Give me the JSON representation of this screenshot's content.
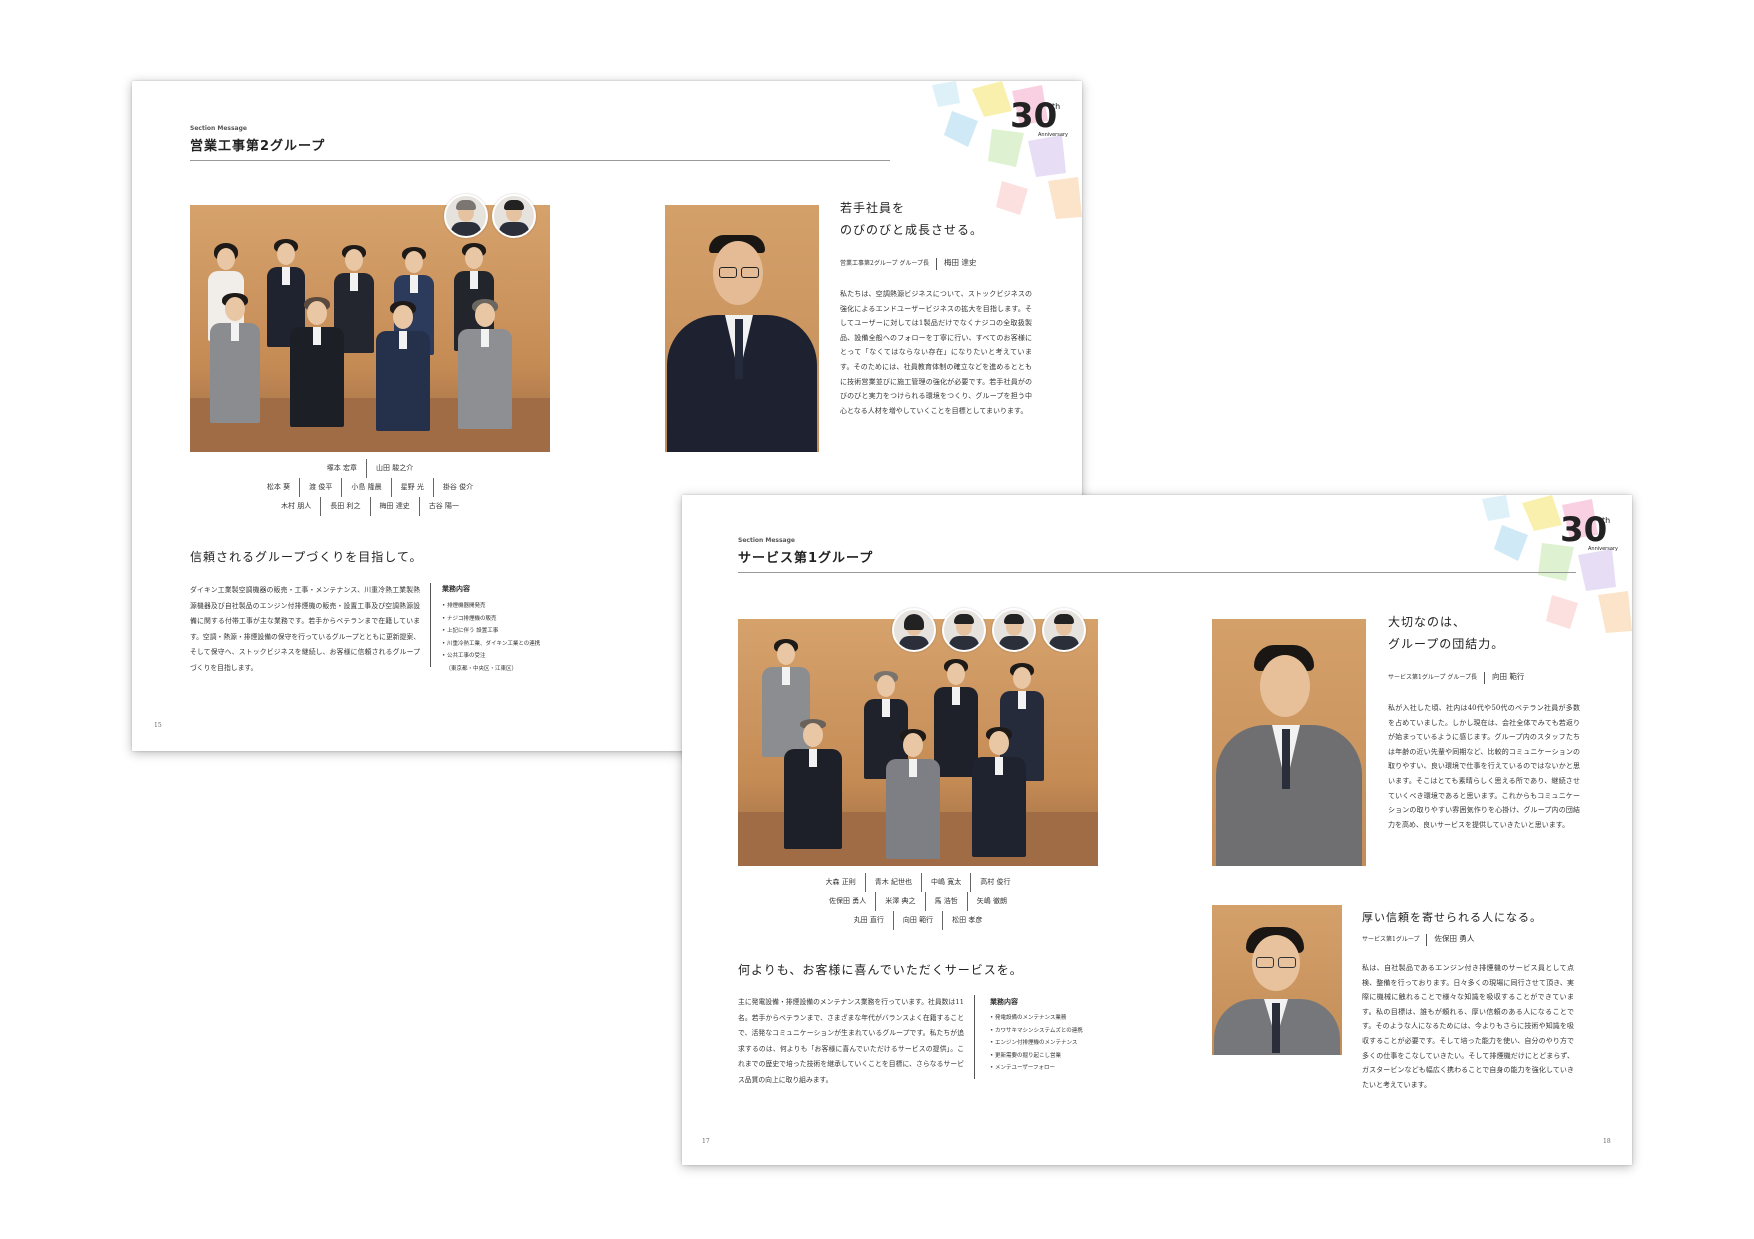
{
  "back_page": {
    "section_label": "Section Message",
    "section_title": "営業工事第2グループ",
    "headline": "若手社員を\nのびのびと成長させる。",
    "leader_role": "営業工事第2グループ グループ長",
    "leader_name": "梅田 達史",
    "leader_message": "私たちは、空調熱源ビジネスについて、ストックビジネスの強化によるエンドユーザービジネスの拡大を目指します。そしてユーザーに対しては1製品だけでなくナジコの全取扱製品、設備全般へのフォローを丁寧に行い、すべてのお客様にとって「なくてはならない存在」になりたいと考えています。そのためには、社員教育体制の確立などを進めるとともに技術営業並びに施工管理の強化が必要です。若手社員がのびのびと実力をつけられる環境をつくり、グループを担う中心となる人材を増やしていくことを目標としてまいります。",
    "name_rows": [
      [
        "塚本 宏章",
        "山田 駿之介"
      ],
      [
        "松本 葵",
        "渡 俊平",
        "小島 隆晨",
        "星野 光",
        "掛谷 俊介"
      ],
      [
        "木村 朋人",
        "長田 利之",
        "梅田 達史",
        "古谷 陽一"
      ]
    ],
    "sub_headline": "信頼されるグループづくりを目指して。",
    "group_desc": "ダイキン工業製空調機器の販売・工事・メンテナンス、川重冷熱工業製熱源機器及び自社製品のエンジン付排煙機の販売・設置工事及び空調熱源設備に関する付帯工事が主な業務です。若手からベテランまで在籍しています。空調・熱源・排煙設備の保守を行っているグループとともに更新提案、そして保守へ、ストックビジネスを継続し、お客様に信頼されるグループづくりを目指します。",
    "biz_title": "業務内容",
    "biz_items": [
      "排煙機器開発売",
      "ナジコ排煙機の販売",
      "上記に伴う 設置工事",
      "川重冷熱工業、ダイキン工業との連携",
      "公共工事の受注",
      "（東京都・中央区・江東区）"
    ],
    "page_number": "15"
  },
  "front_page": {
    "section_label": "Section Message",
    "section_title": "サービス第1グループ",
    "headline": "大切なのは、\nグループの団結力。",
    "leader_role": "サービス第1グループ グループ長",
    "leader_name": "向田 範行",
    "leader_message": "私が入社した頃、社内は40代や50代のベテラン社員が多数を占めていました。しかし現在は、会社全体でみても若返りが始まっているように感じます。グループ内のスタッフたちは年齢の近い先輩や同期など、比較的コミュニケーションの取りやすい、良い環境で仕事を行えているのではないかと思います。そこはとても素晴らしく思える所であり、継続させていくべき環境であると思います。これからもコミュニケーションの取りやすい雰囲気作りを心掛け、グループ内の団結力を高め、良いサービスを提供していきたいと思います。",
    "name_rows": [
      [
        "大森 正則",
        "青木 紀世也",
        "中嶋 寛太",
        "高村 俊行"
      ],
      [
        "佐保田 勇人",
        "米澤 典之",
        "馬 浩哲",
        "矢嶋 徹朗"
      ],
      [
        "丸田 直行",
        "向田 範行",
        "松田 孝彦"
      ]
    ],
    "sub_headline": "何よりも、お客様に喜んでいただくサービスを。",
    "group_desc": "主に発電設備・排煙設備のメンテナンス業務を行っています。社員数は11名。若手からベテランまで、さまざまな年代がバランスよく在籍することで、活発なコミュニケーションが生まれているグループです。私たちが追求するのは、何よりも「お客様に喜んでいただけるサービスの提供」。これまでの歴史で培った技術を継承していくことを目標に、さらなるサービス品質の向上に取り組みます。",
    "biz_title": "業務内容",
    "biz_items": [
      "発電設備のメンテナンス業務",
      "カワサキマシンシステムズとの連携",
      "エンジン付排煙機のメンテナンス",
      "更新需要の掘り起こし営業",
      "メンテユーザーフォロー"
    ],
    "second_headline": "厚い信頼を寄せられる人になる。",
    "second_role": "サービス第1グループ",
    "second_name": "佐保田 勇人",
    "second_message": "私は、自社製品であるエンジン付き排煙機のサービス員として点検、整備を行っております。日々多くの現場に同行させて頂き、実際に機械に触れることで様々な知識を吸収することができています。私の目標は、誰もが頼れる、厚い信頼のある人になることです。そのような人になるためには、今よりもさらに技術や知識を吸収することが必要です。そして培った能力を使い、自分のやり方で多くの仕事をこなしていきたい。そして排煙機だけにとどまらず、ガスタービンなども幅広く携わることで自身の能力を強化していきたいと考えています。",
    "page_number_left": "17",
    "page_number_right": "18"
  },
  "badge": {
    "numeral": "30",
    "suffix": "th",
    "caption": "Anniversary"
  }
}
